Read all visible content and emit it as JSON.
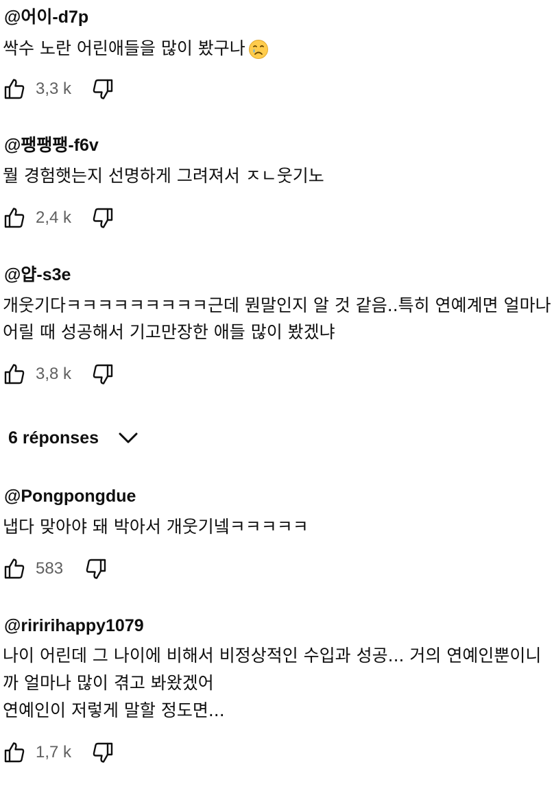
{
  "comments": [
    {
      "author": "@어이-d7p",
      "lines": [
        "싹수 노란 어린애들을 많이 봤구나"
      ],
      "emoji": "crying-face-emoji",
      "likes": "3,3 k"
    },
    {
      "author": "@팽팽팽-f6v",
      "lines": [
        "뭘 경험햇는지 선명하게 그려져서  ㅈㄴ웃기노"
      ],
      "likes": "2,4 k"
    },
    {
      "author": "@얍-s3e",
      "lines": [
        "개웃기다ㅋㅋㅋㅋㅋㅋㅋㅋㅋ근데 뭔말인지 알 것 같음..특히 연예계면 얼마나",
        "어릴 때 성공해서 기고만장한 애들 많이 봤겠냐"
      ],
      "likes": "3,8 k"
    },
    {
      "author": "@Pongpongdue",
      "lines": [
        "냅다 맞아야 돼 박아서 개웃기넼ㅋㅋㅋㅋㅋ"
      ],
      "likes": "583"
    },
    {
      "author": "@riririhappy1079",
      "lines": [
        "나이 어린데 그 나이에 비해서 비정상적인 수입과 성공... 거의 연예인뿐이니",
        "까 얼마나 많이 겪고 봐왔겠어",
        "연예인이 저렇게 말할 정도면..."
      ],
      "likes": "1,7 k"
    }
  ],
  "replies": {
    "label": "6 réponses",
    "icon": "chevron-down-icon"
  },
  "icons": {
    "like": "thumbs-up-icon",
    "dislike": "thumbs-down-icon"
  },
  "colors": {
    "text": "#0f0f0f",
    "secondary_text": "#606060",
    "background": "#ffffff"
  }
}
